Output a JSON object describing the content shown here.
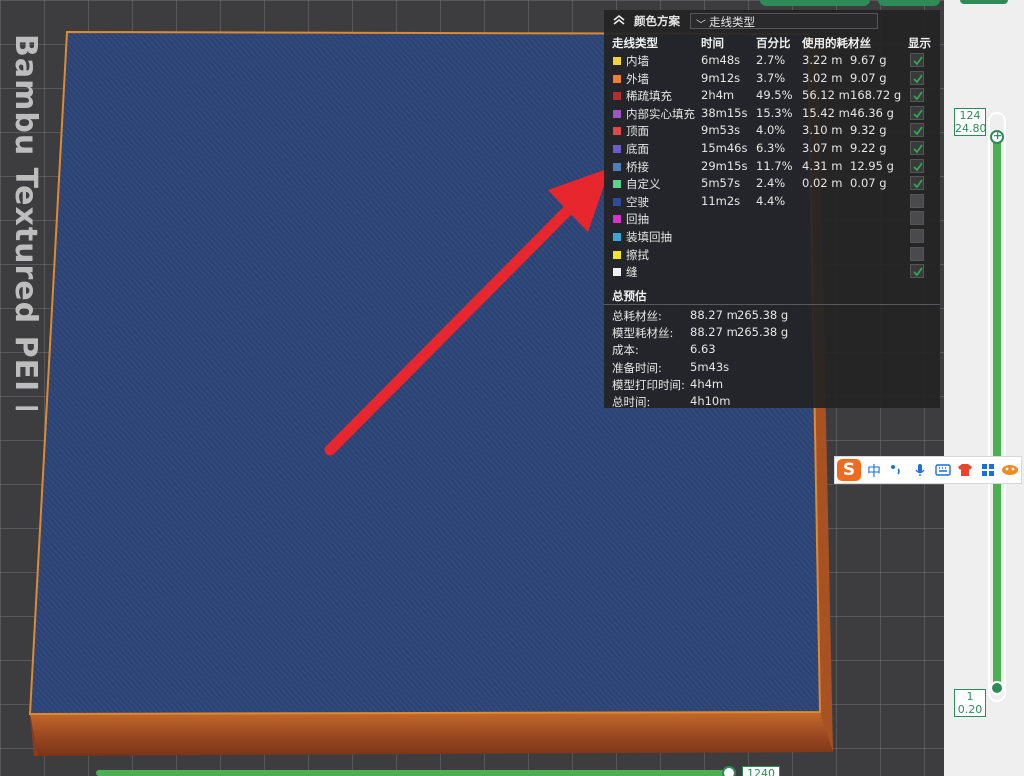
{
  "viewport": {
    "plate_label": "Bambu Textured PEI Plate",
    "bottom_layer_label": "1240"
  },
  "panel": {
    "header": {
      "scheme_label": "颜色方案",
      "scheme_value": "走线类型"
    },
    "columns": {
      "type": "走线类型",
      "time": "时间",
      "percent": "百分比",
      "filament": "使用的耗材丝",
      "display": "显示"
    },
    "rows": [
      {
        "name": "内墙",
        "time": "6m48s",
        "percent": "2.7%",
        "length": "3.22 m",
        "weight": "9.67 g",
        "color": "#f5d33b",
        "checked": true
      },
      {
        "name": "外墙",
        "time": "9m12s",
        "percent": "3.7%",
        "length": "3.02 m",
        "weight": "9.07 g",
        "color": "#f07f36",
        "checked": true
      },
      {
        "name": "稀疏填充",
        "time": "2h4m",
        "percent": "49.5%",
        "length": "56.12 m",
        "weight": "168.72 g",
        "color": "#b03030",
        "checked": true
      },
      {
        "name": "内部实心填充",
        "time": "38m15s",
        "percent": "15.3%",
        "length": "15.42 m",
        "weight": "46.36 g",
        "color": "#9b55c7",
        "checked": true
      },
      {
        "name": "顶面",
        "time": "9m53s",
        "percent": "4.0%",
        "length": "3.10 m",
        "weight": "9.32 g",
        "color": "#e04848",
        "checked": true
      },
      {
        "name": "底面",
        "time": "15m46s",
        "percent": "6.3%",
        "length": "3.07 m",
        "weight": "9.22 g",
        "color": "#6a5cc8",
        "checked": true
      },
      {
        "name": "桥接",
        "time": "29m15s",
        "percent": "11.7%",
        "length": "4.31 m",
        "weight": "12.95 g",
        "color": "#4d7fb8",
        "checked": true
      },
      {
        "name": "自定义",
        "time": "5m57s",
        "percent": "2.4%",
        "length": "0.02 m",
        "weight": "0.07 g",
        "color": "#5fcf8f",
        "checked": true
      },
      {
        "name": "空驶",
        "time": "11m2s",
        "percent": "4.4%",
        "length": "",
        "weight": "",
        "color": "#2f4a9a",
        "checked": false
      },
      {
        "name": "回抽",
        "time": "",
        "percent": "",
        "length": "",
        "weight": "",
        "color": "#d633c8",
        "checked": false
      },
      {
        "name": "装填回抽",
        "time": "",
        "percent": "",
        "length": "",
        "weight": "",
        "color": "#38a8d8",
        "checked": false
      },
      {
        "name": "擦拭",
        "time": "",
        "percent": "",
        "length": "",
        "weight": "",
        "color": "#f2e62a",
        "checked": false
      },
      {
        "name": "缝",
        "time": "",
        "percent": "",
        "length": "",
        "weight": "",
        "color": "#f0f0f0",
        "checked": true
      }
    ],
    "estimate": {
      "title": "总预估",
      "rows": [
        {
          "label": "总耗材丝:",
          "v1": "88.27 m",
          "v2": "265.38 g"
        },
        {
          "label": "模型耗材丝:",
          "v1": "88.27 m",
          "v2": "265.38 g"
        },
        {
          "label": "成本:",
          "v1": "6.63",
          "v2": ""
        },
        {
          "label": "准备时间:",
          "v1": "5m43s",
          "v2": ""
        },
        {
          "label": "模型打印时间:",
          "v1": "4h4m",
          "v2": ""
        },
        {
          "label": "总时间:",
          "v1": "4h10m",
          "v2": ""
        }
      ]
    }
  },
  "layer_slider": {
    "top_layer": "124",
    "top_height": "24.80",
    "bottom_layer": "1",
    "bottom_height": "0.20"
  },
  "ime": {
    "logo": "S",
    "lang": "中"
  },
  "colors": {
    "accent": "#2e8b57",
    "arrow": "#e8262e",
    "model_edge": "#c8762a",
    "model_top": "#2c4373"
  }
}
